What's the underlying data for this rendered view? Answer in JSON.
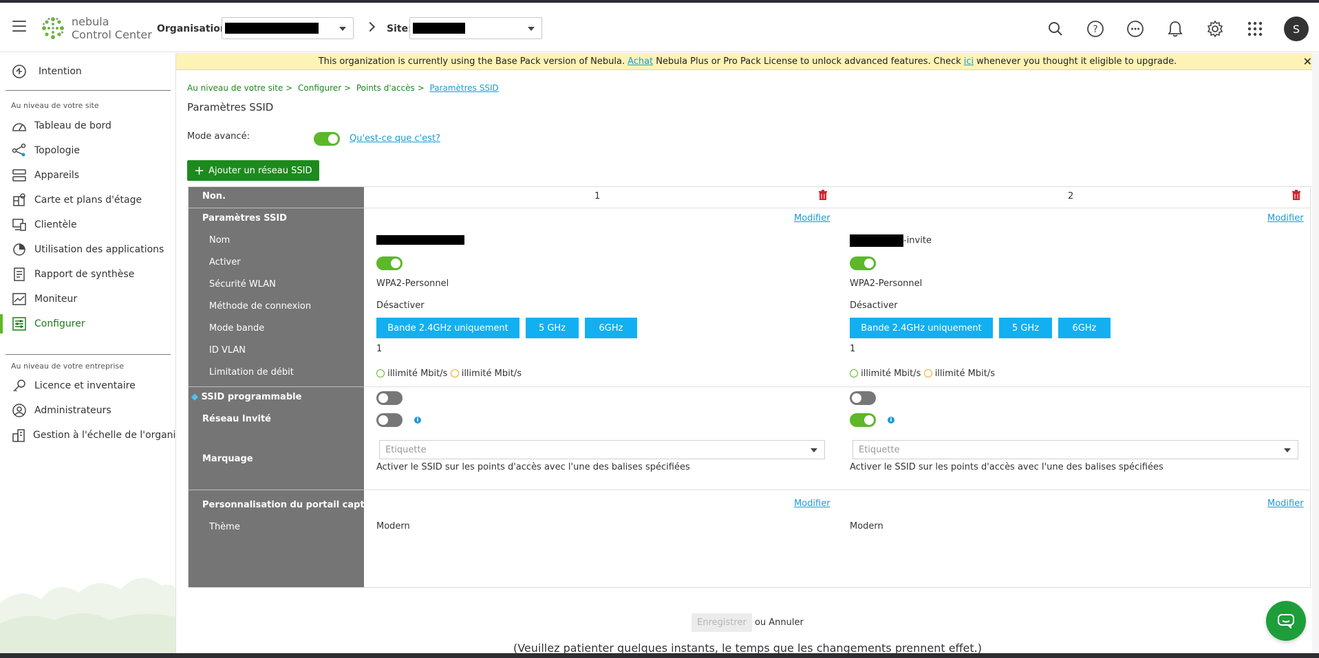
{
  "header": {
    "logo_line1": "nebula",
    "logo_line2": "Control Center",
    "org_label": "Organisation:",
    "site_label": "Site:",
    "avatar_letter": "S"
  },
  "banner": {
    "text_before": "This organization is currently using the Base Pack version of Nebula.",
    "link1": "Achat",
    "text_middle": "Nebula Plus or Pro Pack License to unlock advanced features. Check",
    "link2": "ici",
    "text_after": "whenever you thought it eligible to upgrade.",
    "close": "✕"
  },
  "sidebar": {
    "intention": "Intention",
    "section_site": "Au niveau de votre site",
    "items_site": [
      {
        "label": "Tableau de bord",
        "icon": "dashboard-icon"
      },
      {
        "label": "Topologie",
        "icon": "topology-icon"
      },
      {
        "label": "Appareils",
        "icon": "devices-icon"
      },
      {
        "label": "Carte et plans d'étage",
        "icon": "map-icon"
      },
      {
        "label": "Clientèle",
        "icon": "clients-icon"
      },
      {
        "label": "Utilisation des applications",
        "icon": "pie-chart-icon"
      },
      {
        "label": "Rapport de synthèse",
        "icon": "report-icon"
      },
      {
        "label": "Moniteur",
        "icon": "monitor-icon"
      },
      {
        "label": "Configurer",
        "icon": "configure-icon"
      }
    ],
    "section_org": "Au niveau de votre entreprise",
    "items_org": [
      {
        "label": "Licence et inventaire",
        "icon": "license-icon"
      },
      {
        "label": "Administrateurs",
        "icon": "admin-icon"
      },
      {
        "label": "Gestion à l'échelle de l'organisc",
        "icon": "org-management-icon"
      }
    ]
  },
  "breadcrumb": {
    "part1": "Au niveau de votre site >",
    "part2": "Configurer >",
    "part3": "Points d'accès >",
    "current": "Paramètres SSID"
  },
  "page": {
    "title": "Paramètres SSID",
    "advanced_mode_label": "Mode avancé:",
    "advanced_mode_on": true,
    "what_is_it_link": "Qu'est-ce que c'est?",
    "add_button": "Ajouter un réseau SSID"
  },
  "table": {
    "labels": {
      "num": "Non.",
      "ssid_settings": "Paramètres SSID",
      "name": "Nom",
      "enable": "Activer",
      "wlan_security": "Sécurité WLAN",
      "login_method": "Méthode de connexion",
      "band_mode": "Mode bande",
      "vlan_id": "ID VLAN",
      "rate_limit": "Limitation de débit",
      "programmable_ssid": "SSID programmable",
      "guest_network": "Réseau Invité",
      "tagging": "Marquage",
      "captive_portal": "Personnalisation du portail captif",
      "theme": "Thème"
    },
    "columns": [
      {
        "number": "1",
        "modify": "Modifier",
        "name_suffix": "",
        "enabled": true,
        "security": "WPA2-Personnel",
        "login": "Désactiver",
        "bands": [
          "Bande 2.4GHz uniquement",
          "5 GHz",
          "6GHz"
        ],
        "vlan": "1",
        "rate_down": "illimité Mbit/s",
        "rate_up": "illimité Mbit/s",
        "programmable": false,
        "guest": false,
        "tag_placeholder": "Etiquette",
        "tag_help": "Activer le SSID sur les points d'accès avec l'une des balises spécifiées",
        "portal_modify": "Modifier",
        "theme": "Modern"
      },
      {
        "number": "2",
        "modify": "Modifier",
        "name_suffix": "-invite",
        "enabled": true,
        "security": "WPA2-Personnel",
        "login": "Désactiver",
        "bands": [
          "Bande 2.4GHz uniquement",
          "5 GHz",
          "6GHz"
        ],
        "vlan": "1",
        "rate_down": "illimité Mbit/s",
        "rate_up": "illimité Mbit/s",
        "programmable": false,
        "guest": true,
        "tag_placeholder": "Etiquette",
        "tag_help": "Activer le SSID sur les points d'accès avec l'une des balises spécifiées",
        "portal_modify": "Modifier",
        "theme": "Modern"
      }
    ]
  },
  "footer": {
    "save": "Enregistrer",
    "or_cancel": "ou Annuler",
    "note": "(Veuillez patienter quelques instants, le temps que les changements prennent effet.)"
  },
  "colors": {
    "accent_green": "#5cb82a",
    "band_blue": "#12b0f0",
    "link_blue": "#1a9cd8",
    "label_gray": "#757575",
    "banner_yellow": "#fdf3b5"
  }
}
